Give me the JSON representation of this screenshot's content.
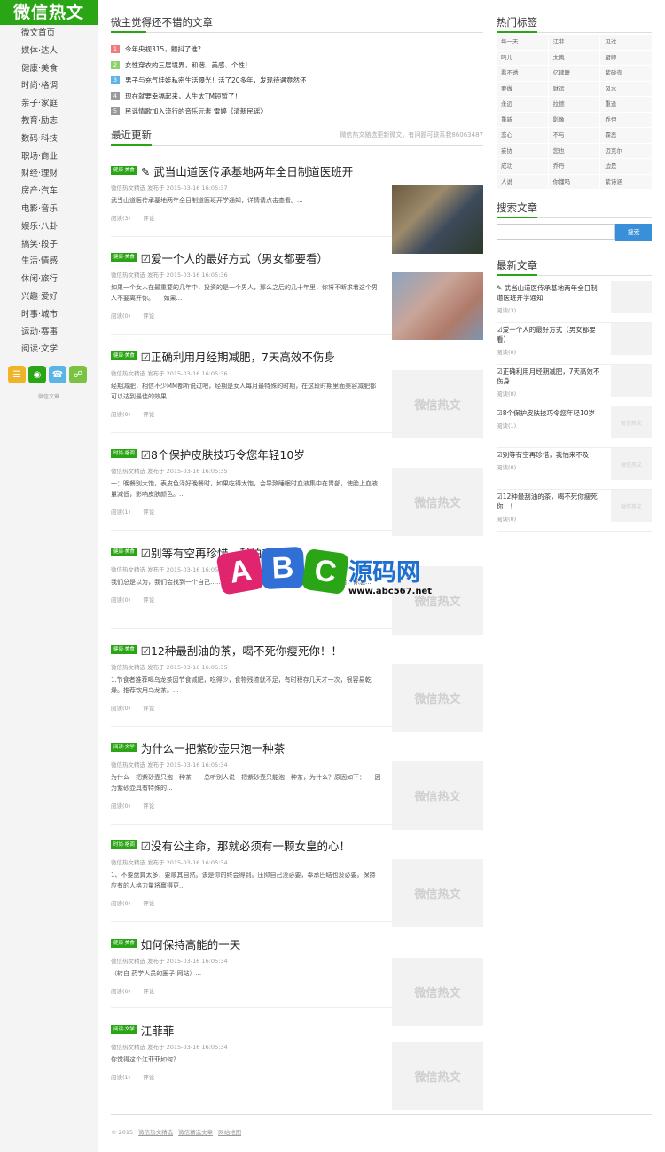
{
  "site": {
    "logo": "微信热文",
    "footer_label": "微信文章"
  },
  "nav": [
    "微文首页",
    "媒体·达人",
    "健康·美食",
    "时尚·格调",
    "亲子·家庭",
    "教育·励志",
    "数码·科技",
    "职场·商业",
    "财经·理财",
    "房产·汽车",
    "电影·音乐",
    "娱乐·八卦",
    "搞笑·段子",
    "生活·情感",
    "休闲·旅行",
    "兴趣·爱好",
    "时事·城市",
    "运动·赛事",
    "阅读·文学"
  ],
  "social_icons": [
    "rss-icon",
    "weibo-icon",
    "qq-icon",
    "wechat-icon"
  ],
  "section_top": {
    "title": "微主觉得还不错的文章",
    "items": [
      {
        "num": "1",
        "text": "今年央视315，颤抖了谁？"
      },
      {
        "num": "2",
        "text": "女性穿衣的三层境界，和谐、美感、个性！"
      },
      {
        "num": "3",
        "text": "男子与充气娃娃私密生活曝光！活了20多年，发现待遇竟然还"
      },
      {
        "num": "4",
        "text": "现在就要幸福起来，人生太TM短暂了！"
      },
      {
        "num": "5",
        "text": "民谣情歌加入流行的音乐元素 雷婷《清新民谣》"
      }
    ]
  },
  "section_recent": {
    "title": "最近更新",
    "note": "微信热文随选更新微文，有问题可联系我86063487"
  },
  "placeholder_thumb": "微信热文",
  "articles": [
    {
      "tag": "健康·美食",
      "title": "✎ 武当山道医传承基地两年全日制道医班开",
      "meta": "微信热文精选 发布于 2015-03-16 16:05:37",
      "desc": "武当山道医传承基地两年全日制道医班开学通知，详情请点击查看。...",
      "read": "阅读(3)",
      "comment": "评论"
    },
    {
      "tag": "健康·美食",
      "title": "☑爱一个人的最好方式（男女都要看）",
      "meta": "微信热文精选 发布于 2015-03-16 16:05:36",
      "desc": "如果一个女人在最重要的几年中，投资的是一个男人，那么之后的几十年里，你将不断求着这个男人不要离开你。　　如果...",
      "read": "阅读(0)",
      "comment": "评论"
    },
    {
      "tag": "健康·美食",
      "title": "☑正确利用月经期减肥，7天高效不伤身",
      "meta": "微信热文精选 发布于 2015-03-16 16:05:36",
      "desc": "经期减肥，相信不少MM都听说过吧，经期是女人每月最特殊的时期，在这段时期里面美容减肥都可以达到最佳的效果，...",
      "read": "阅读(0)",
      "comment": "评论"
    },
    {
      "tag": "时尚·格调",
      "title": "☑8个保护皮肤技巧令您年轻10岁",
      "meta": "微信热文精选 发布于 2015-03-16 16:05:35",
      "desc": "一：晚餐别太饱，表皮色泽好晚餐时，如果吃得太饱，会导致睡眠时血液集中在胃部，使脸上血液量减低，影响皮肤颜色。...",
      "read": "阅读(1)",
      "comment": "评论"
    },
    {
      "tag": "健康·美食",
      "title": "☑别等有空再珍惜，我怕来不及",
      "meta": "微信热文精选 发布于 2015-03-16 16:05:35",
      "desc": "我们总是以为，我们会找到一个自己……然后开始。经经多么天真。假如从来没有开始，你怎...",
      "read": "阅读(0)",
      "comment": "评论"
    },
    {
      "tag": "健康·美食",
      "title": "☑12种最刮油的茶，喝不死你瘦死你！！",
      "meta": "微信热文精选 发布于 2015-03-16 16:05:35",
      "desc": "1.节食者推荐喝乌龙茶因节食减肥，吃得少，食物残渣就不足，有时积存几天才一次，很容易乾燥。推荐饮用乌龙茶。...",
      "read": "阅读(0)",
      "comment": "评论"
    },
    {
      "tag": "阅读·文学",
      "title": "为什么一把紫砂壶只泡一种茶",
      "meta": "微信热文精选 发布于 2015-03-16 16:05:34",
      "desc": "为什么一把紫砂壶只泡一种茶　　总听别人说一把紫砂壶只能泡一种茶，为什么？原因如下：　　因为紫砂壶具有特殊的...",
      "read": "阅读(0)",
      "comment": "评论"
    },
    {
      "tag": "时尚·格调",
      "title": "☑没有公主命，那就必须有一颗女皇的心！",
      "meta": "微信热文精选 发布于 2015-03-16 16:05:34",
      "desc": "1、不要盘算太多，要顺其自然。该是你的终会得到。压抑自己没必要，奉承巴结也没必要。保持应有的人格力量将赢得更...",
      "read": "阅读(0)",
      "comment": "评论"
    },
    {
      "tag": "健康·美食",
      "title": "如何保持高能的一天",
      "meta": "微信热文精选 发布于 2015-03-16 16:05:34",
      "desc": "（转自 药学人员的圈子 网站）...",
      "read": "阅读(0)",
      "comment": "评论"
    },
    {
      "tag": "阅读·文学",
      "title": "江菲菲",
      "meta": "微信热文精选 发布于 2015-03-16 16:05:34",
      "desc": "你觉得这个江菲菲如何？...",
      "read": "阅读(1)",
      "comment": "评论"
    }
  ],
  "hot_tags": {
    "title": "热门标签",
    "items": [
      "每一天",
      "江菲",
      "见过",
      "吗儿",
      "太奥",
      "厨师",
      "看不透",
      "亿建联",
      "紫砂壶",
      "要做",
      "财运",
      "风水",
      "永远",
      "拉德",
      "重逢",
      "重新",
      "影像",
      "乔伊",
      "恋心",
      "不与",
      "霖恶",
      "妄协",
      "您也",
      "迈克尔",
      "成功",
      "乔丹",
      "边是",
      "人说",
      "你懂吗",
      "紫诗涵"
    ]
  },
  "search": {
    "title": "搜索文章",
    "button": "搜索",
    "placeholder": ""
  },
  "newest": {
    "title": "最新文章",
    "items": [
      {
        "title": "✎ 武当山道医传承基地两年全日制道医班开学通知",
        "read": "阅读(3)"
      },
      {
        "title": "☑爱一个人的最好方式（男女都要看）",
        "read": "阅读(0)"
      },
      {
        "title": "☑正确利用月经期减肥，7天高效不伤身",
        "read": "阅读(0)"
      },
      {
        "title": "☑8个保护皮肤技巧令您年轻10岁",
        "read": "阅读(1)"
      },
      {
        "title": "☑别等有空再珍惜，我怕来不及",
        "read": "阅读(0)"
      },
      {
        "title": "☑12种最刮油的茶，喝不死你瘦死你！！",
        "read": "阅读(0)"
      }
    ]
  },
  "footer": {
    "copy": "© 2015",
    "link1": "微信热文精选",
    "link2": "微信精选文章",
    "link3": "网站地图"
  },
  "watermark": {
    "a": "A",
    "b": "B",
    "c": "C",
    "brand": "源码网",
    "url": "www.abc567.net"
  }
}
